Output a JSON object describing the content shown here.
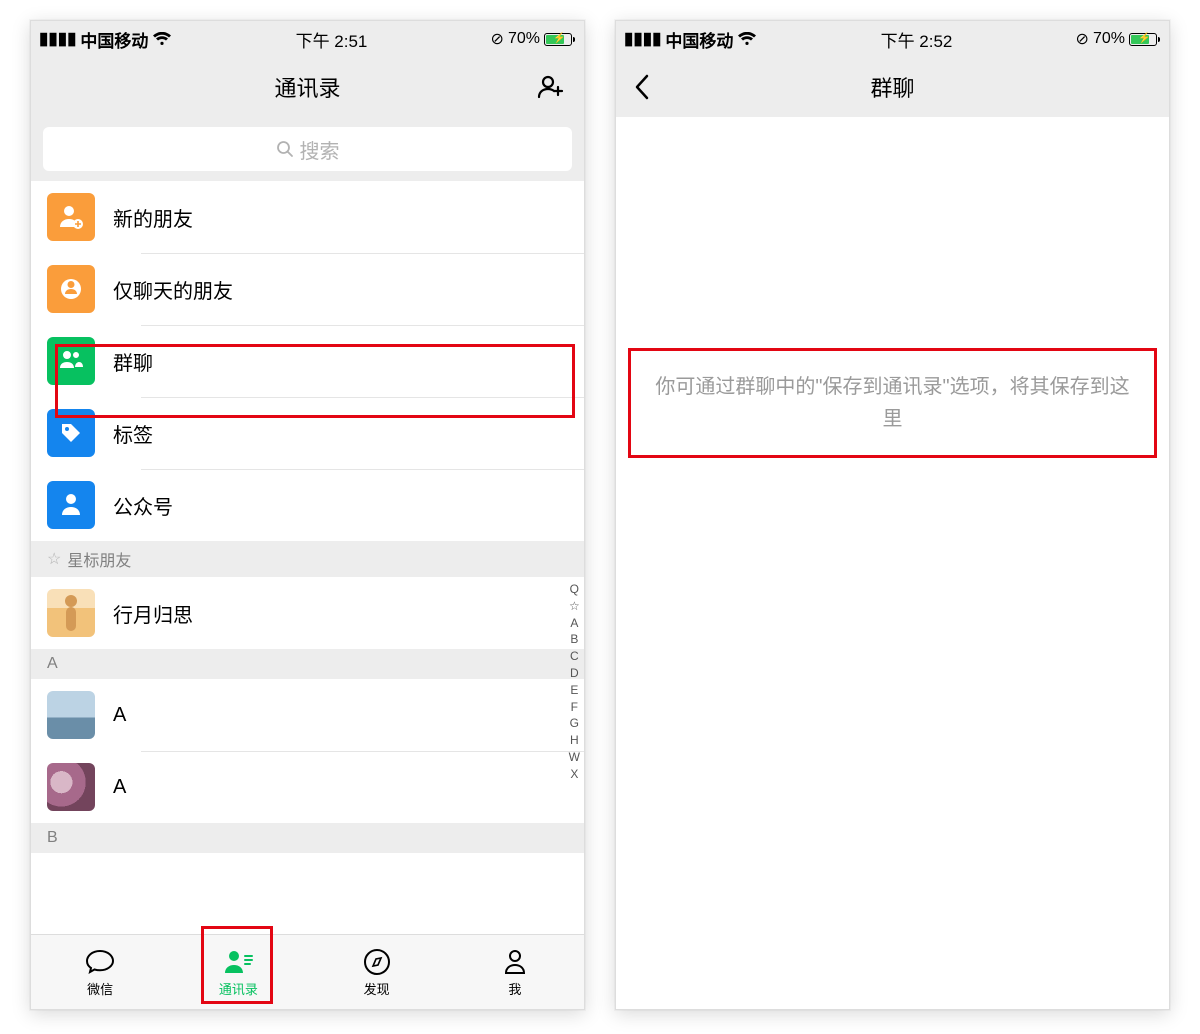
{
  "left": {
    "status": {
      "carrier": "中国移动",
      "time": "下午 2:51",
      "battery_pct": "70%"
    },
    "nav_title": "通讯录",
    "search_placeholder": "搜索",
    "items": [
      {
        "label": "新的朋友"
      },
      {
        "label": "仅聊天的朋友"
      },
      {
        "label": "群聊"
      },
      {
        "label": "标签"
      },
      {
        "label": "公众号"
      }
    ],
    "starred_header": "星标朋友",
    "contacts_star": [
      {
        "name": "行月归思"
      }
    ],
    "section_a": "A",
    "contacts_a": [
      {
        "name": "A"
      },
      {
        "name": "A"
      }
    ],
    "section_b": "B",
    "index": [
      "Q",
      "☆",
      "A",
      "B",
      "C",
      "D",
      "E",
      "F",
      "G",
      "H",
      "W",
      "X"
    ],
    "tabs": [
      {
        "label": "微信"
      },
      {
        "label": "通讯录"
      },
      {
        "label": "发现"
      },
      {
        "label": "我"
      }
    ]
  },
  "right": {
    "status": {
      "carrier": "中国移动",
      "time": "下午 2:52",
      "battery_pct": "70%"
    },
    "nav_title": "群聊",
    "empty_msg": "你可通过群聊中的\"保存到通讯录\"选项，将其保存到这里"
  }
}
